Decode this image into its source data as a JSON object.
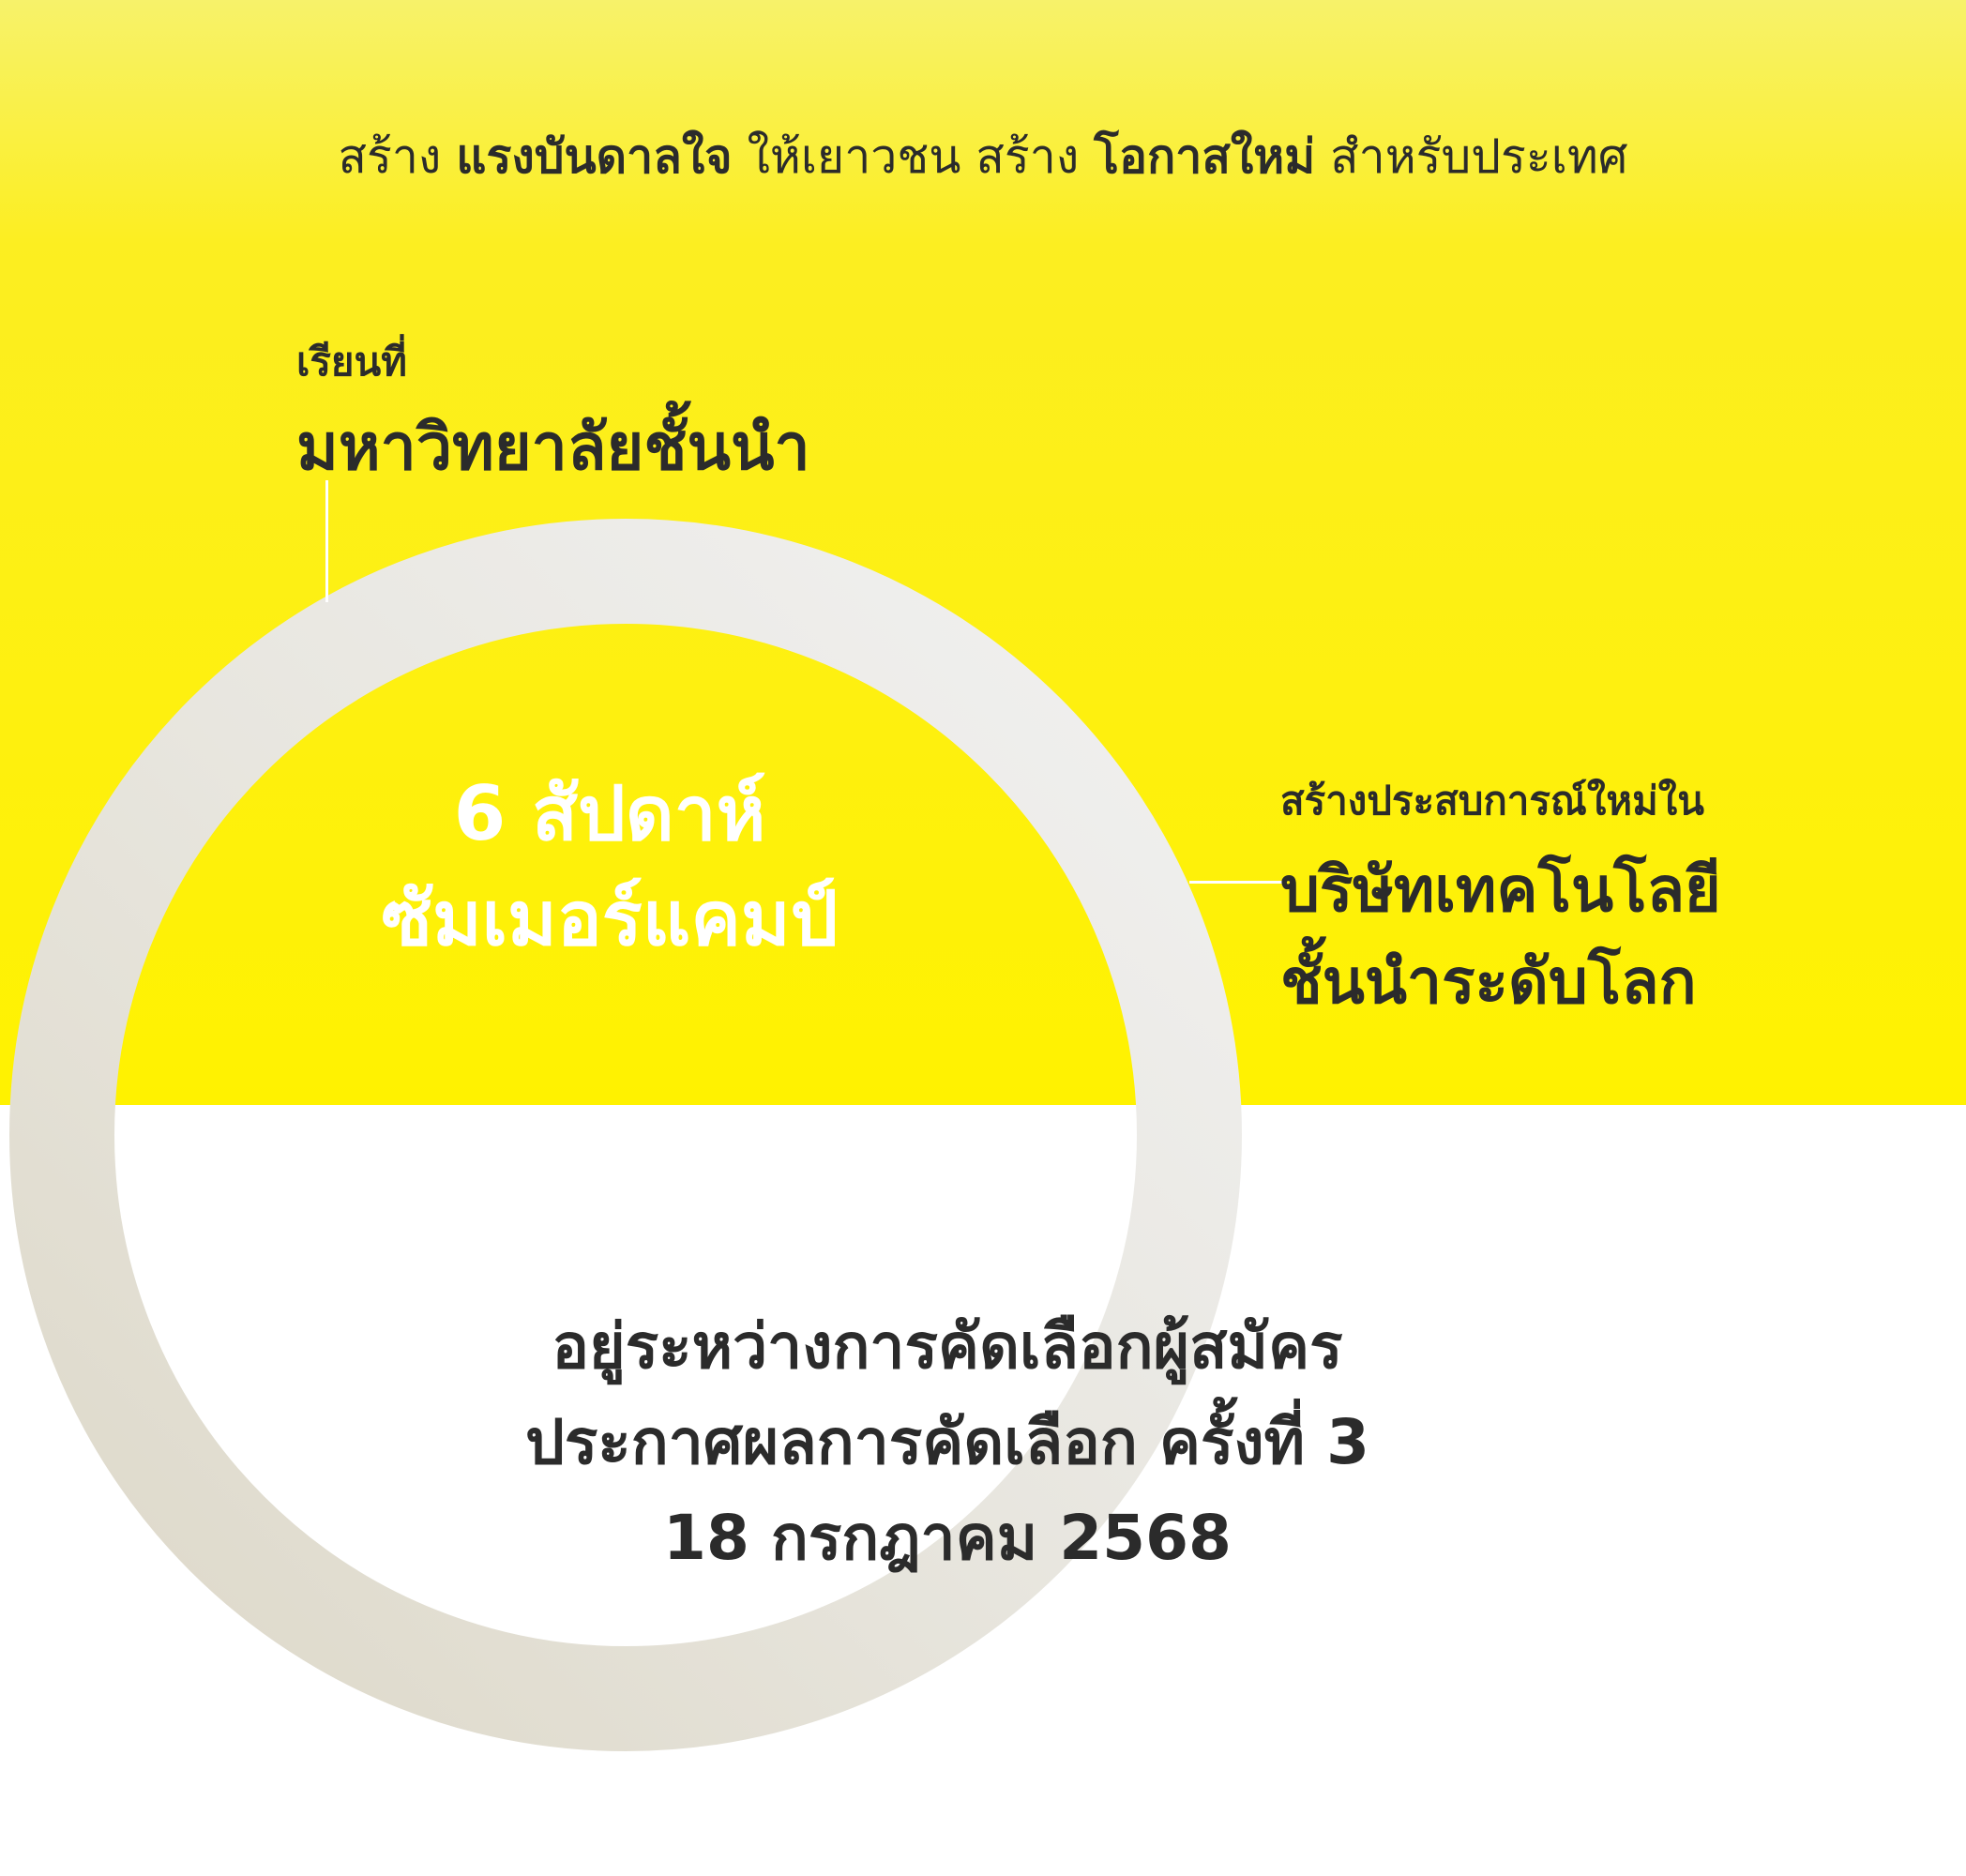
{
  "colors": {
    "yellow": "#fff200",
    "yellow_light": "#f7f26a",
    "ring": "#e8e4da",
    "text_dark": "#2b2b2b",
    "text_light": "#ffffff"
  },
  "tagline": {
    "part1": "สร้าง ",
    "bold1": "แรงบันดาลใจ",
    "part2": " ให้เยาวชน สร้าง ",
    "bold2": "โอกาสใหม่",
    "part3": " สำหรับประเทศ"
  },
  "university": {
    "small": "เรียนที่",
    "big": "มหาวิทยาลัยชั้นนำ"
  },
  "center": {
    "line1": "6 สัปดาห์",
    "line2": "ซัมเมอร์แคมป์"
  },
  "tech": {
    "small": "สร้างประสบการณ์ใหม่ใน",
    "big_line1": "บริษัทเทคโนโลยี",
    "big_line2": "ชั้นนำระดับโลก"
  },
  "status": {
    "line1": "อยู่ระหว่างการคัดเลือกผู้สมัคร",
    "line2": "ประกาศผลการคัดเลือก ครั้งที่ 3",
    "line3": "18 กรกฎาคม 2568"
  }
}
